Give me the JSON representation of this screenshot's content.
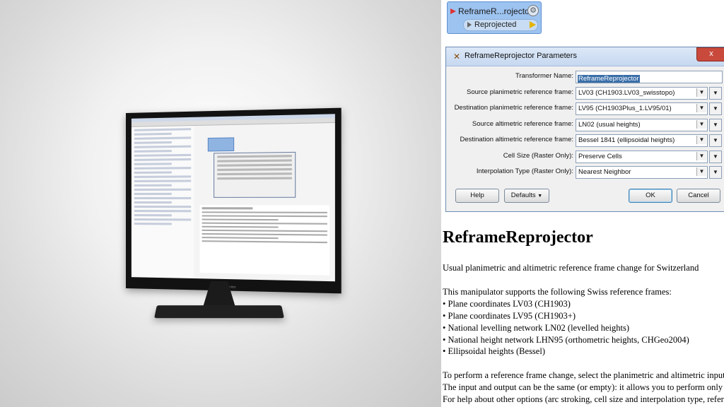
{
  "monitor": {
    "brand": "Monitor"
  },
  "node": {
    "title": "ReframeR...rojector",
    "port_label": "Reprojected"
  },
  "dialog": {
    "title": "ReframeReprojector Parameters",
    "close_label": "x",
    "fields": [
      {
        "label": "Transformer Name:",
        "value": "ReframeReprojector",
        "type": "text"
      },
      {
        "label": "Source planimetric reference frame:",
        "value": "LV03 (CH1903.LV03_swisstopo)",
        "type": "combo"
      },
      {
        "label": "Destination planimetric reference frame:",
        "value": "LV95 (CH1903Plus_1.LV95/01)",
        "type": "combo"
      },
      {
        "label": "Source altimetric reference frame:",
        "value": "LN02 (usual heights)",
        "type": "combo"
      },
      {
        "label": "Destination altimetric reference frame:",
        "value": "Bessel 1841 (ellipsoidal heights)",
        "type": "combo"
      },
      {
        "label": "Cell Size (Raster Only):",
        "value": "Preserve Cells",
        "type": "combo"
      },
      {
        "label": "Interpolation Type (Raster Only):",
        "value": "Nearest Neighbor",
        "type": "combo"
      }
    ],
    "buttons": {
      "help": "Help",
      "defaults": "Defaults",
      "ok": "OK",
      "cancel": "Cancel"
    }
  },
  "doc": {
    "title": "ReframeReprojector",
    "intro": "Usual planimetric and altimetric reference frame change for Switzerland",
    "supports": "This manipulator supports the following Swiss reference frames:",
    "items": [
      "• Plane coordinates LV03 (CH1903)",
      "• Plane coordinates LV95 (CH1903+)",
      "• National levelling network LN02 (levelled heights)",
      "• National height network LHN95 (orthometric heights, CHGeo2004)",
      "• Ellipsoidal heights (Bessel)"
    ],
    "para": [
      "To perform a reference frame change, select the planimetric and altimetric input",
      "The input and output can be the same (or empty): it allows you to perform only",
      "For help about other options (arc stroking, cell size and interpolation type, refer"
    ]
  }
}
